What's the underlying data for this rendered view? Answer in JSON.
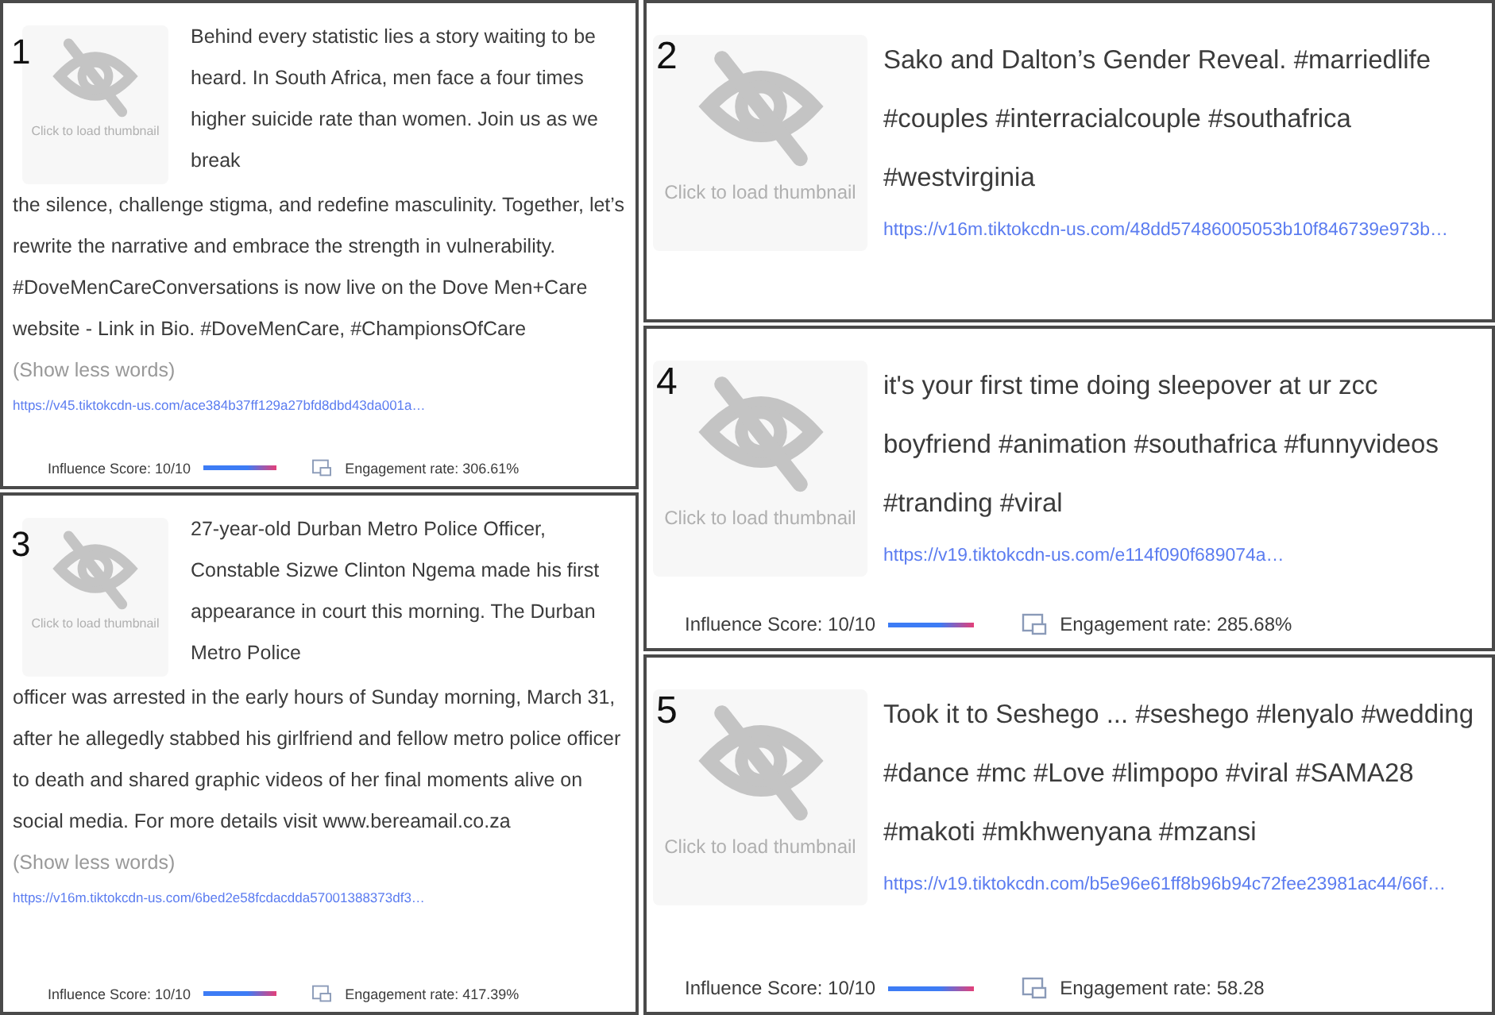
{
  "left_column": [
    {
      "number": "1",
      "thumbnail_label": "Click to load thumbnail",
      "caption_beside": "Behind every statistic lies a story waiting to be heard. In South Africa, men face a four times higher suicide rate than women. Join us as we break",
      "caption_below": "the silence, challenge stigma, and redefine masculinity. Together, let’s rewrite the narrative and embrace the strength in vulnerability. #DoveMenCareConversations is now live on the Dove Men+Care website - Link in Bio. #DoveMenCare, #ChampionsOfCare",
      "toggle": "(Show less words)",
      "url": "https://v45.tiktokcdn-us.com/ace384b37ff129a27bfd8dbd43da001a…",
      "influence": "Influence Score: 10/10",
      "level": 1,
      "engagement": "Engagement rate: 306.61%"
    },
    {
      "number": "3",
      "thumbnail_label": "Click to load thumbnail",
      "caption_beside": "27-year-old Durban Metro Police Officer, Constable Sizwe Clinton Ngema made his first appearance in court this morning. The Durban Metro Police",
      "caption_below": "officer was arrested in the early hours of Sunday morning, March 31, after he allegedly stabbed his girlfriend and fellow metro police officer to death and shared graphic videos of her final moments alive on social media. For more details visit www.bereamail.co.za",
      "toggle": "(Show less words)",
      "url": "https://v16m.tiktokcdn-us.com/6bed2e58fcdacdda57001388373df3…",
      "influence": "Influence Score: 10/10",
      "level": 1,
      "engagement": "Engagement rate: 417.39%"
    }
  ],
  "right_column": [
    {
      "number": "2",
      "thumbnail_label": "Click to load thumbnail",
      "caption_beside": "Sako and Dalton’s Gender Reveal. #marriedlife #couples #interracialcouple #southafrica #westvirginia",
      "url": "https://v16m.tiktokcdn-us.com/48dd57486005053b10f846739e973b…"
    },
    {
      "number": "4",
      "thumbnail_label": "Click to load thumbnail",
      "caption_beside": "it's your first time doing sleepover at ur zcc boyfriend #animation #southafrica #funnyvideos #tranding #viral",
      "url": "https://v19.tiktokcdn-us.com/e114f090f689074a…",
      "influence": "Influence Score: 10/10",
      "level": 1,
      "engagement": "Engagement rate: 285.68%"
    },
    {
      "number": "5",
      "thumbnail_label": "Click to load thumbnail",
      "caption_beside": "Took it to Seshego ... #seshego #lenyalo #wedding #dance #mc #Love #limpopo #viral #SAMA28 #makoti #mkhwenyana #mzansi",
      "url": "https://v19.tiktokcdn.com/b5e96e61ff8b96b94c72fee23981ac44/66f…",
      "influence": "Influence Score: 10/10",
      "level": 1,
      "engagement": "Engagement rate: 58.28"
    }
  ]
}
